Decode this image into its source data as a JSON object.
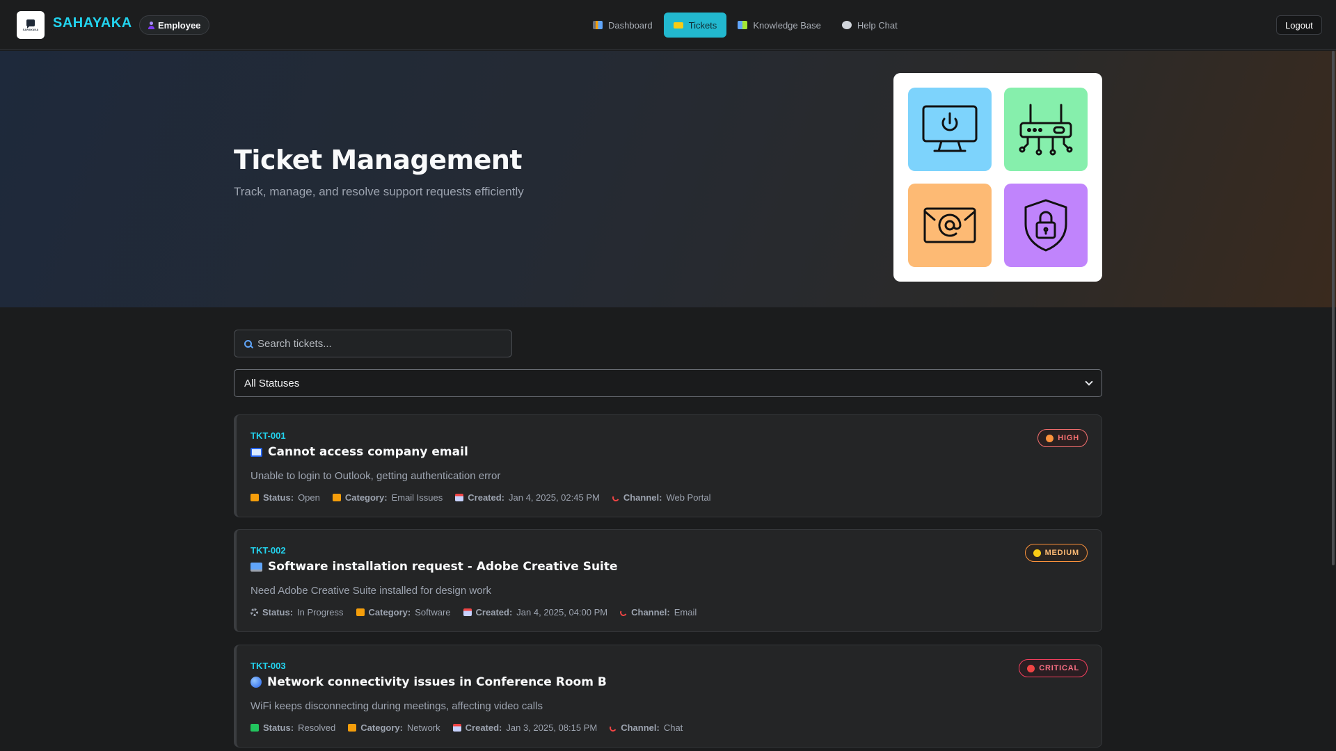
{
  "app": {
    "brand": "SAHAYAKA",
    "logo_text": "SAHAYAKA",
    "role": "Employee"
  },
  "nav": {
    "items": [
      {
        "label": "Dashboard",
        "icon": "bar-chart-icon"
      },
      {
        "label": "Tickets",
        "icon": "ticket-icon",
        "active": true
      },
      {
        "label": "Knowledge Base",
        "icon": "books-icon"
      },
      {
        "label": "Help Chat",
        "icon": "speech-bubble-icon"
      }
    ],
    "logout": "Logout"
  },
  "hero": {
    "title": "Ticket Management",
    "subtitle": "Track, manage, and resolve support requests efficiently",
    "tiles": [
      "monitor-power-icon",
      "router-icon",
      "email-at-icon",
      "shield-lock-icon"
    ]
  },
  "search": {
    "placeholder": "Search tickets..."
  },
  "filter": {
    "selected": "All Statuses"
  },
  "labels": {
    "status": "Status:",
    "category": "Category:",
    "created": "Created:",
    "channel": "Channel:"
  },
  "tickets": [
    {
      "id": "TKT-001",
      "title": "Cannot access company email",
      "description": "Unable to login to Outlook, getting authentication error",
      "status": "Open",
      "category": "Email Issues",
      "created": "Jan 4, 2025, 02:45 PM",
      "channel": "Web Portal",
      "priority": "HIGH"
    },
    {
      "id": "TKT-002",
      "title": "Software installation request - Adobe Creative Suite",
      "description": "Need Adobe Creative Suite installed for design work",
      "status": "In Progress",
      "category": "Software",
      "created": "Jan 4, 2025, 04:00 PM",
      "channel": "Email",
      "priority": "MEDIUM"
    },
    {
      "id": "TKT-003",
      "title": "Network connectivity issues in Conference Room B",
      "description": "WiFi keeps disconnecting during meetings, affecting video calls",
      "status": "Resolved",
      "category": "Network",
      "created": "Jan 3, 2025, 08:15 PM",
      "channel": "Chat",
      "priority": "CRITICAL"
    }
  ],
  "colors": {
    "accent": "#22d3ee",
    "active_tab": "#22b8cf",
    "high": "#f87171",
    "medium": "#fb923c",
    "critical": "#f43f5e"
  }
}
